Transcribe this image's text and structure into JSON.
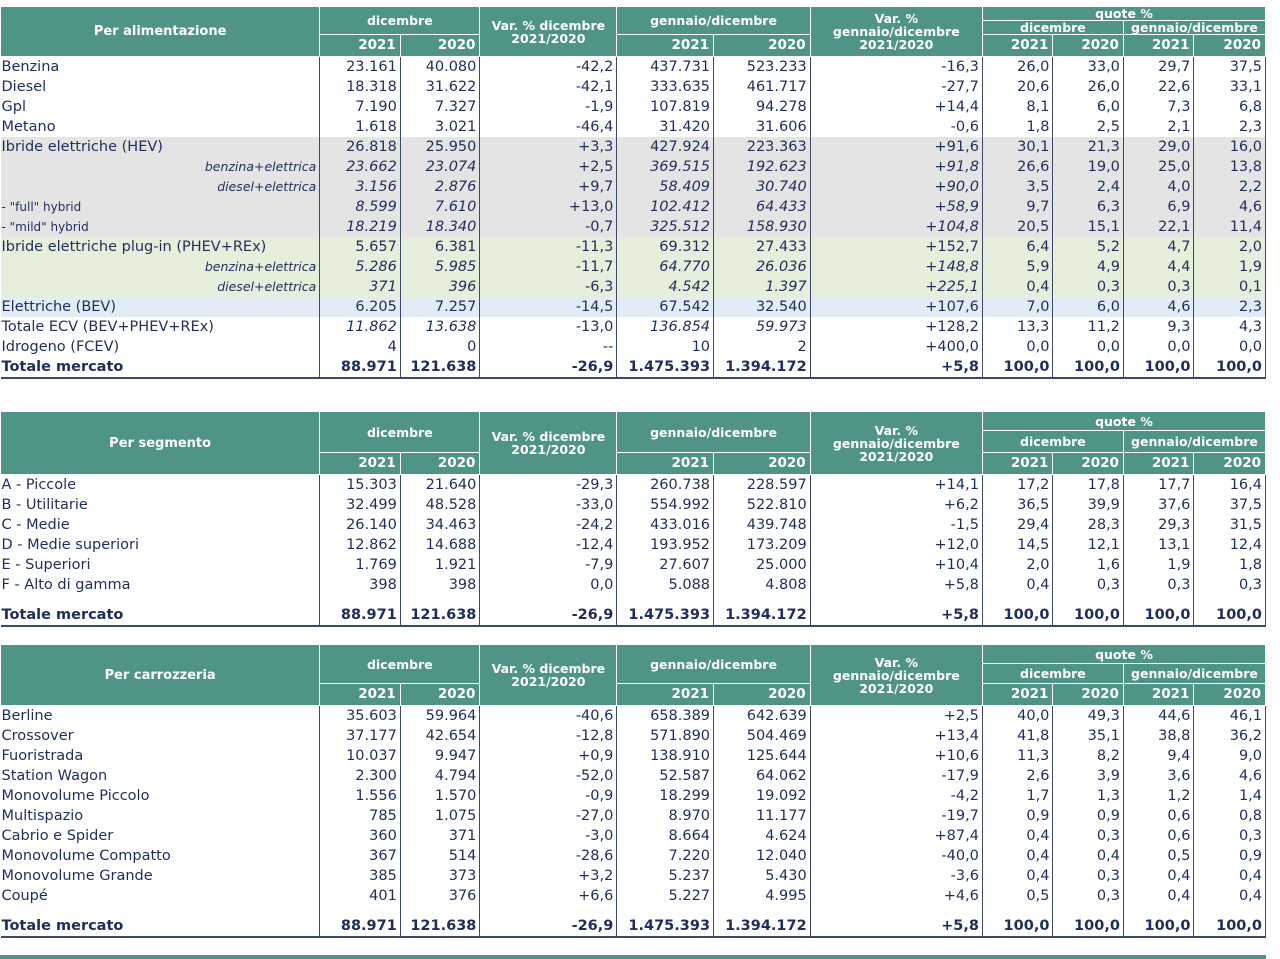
{
  "labels": {
    "dicembre": "dicembre",
    "gennaio_dicembre": "gennaio/dicembre",
    "var_dic": "Var. % dicembre 2021/2020",
    "var_gen": "Var. % gennaio/dicembre 2021/2020",
    "quote": "quote %",
    "y2021": "2021",
    "y2020": "2020"
  },
  "alimentazione": {
    "title": "Per alimentazione",
    "rows": [
      [
        "Benzina",
        "23.161",
        "40.080",
        "-42,2",
        "437.731",
        "523.233",
        "-16,3",
        "26,0",
        "33,0",
        "29,7",
        "37,5"
      ],
      [
        "Diesel",
        "18.318",
        "31.622",
        "-42,1",
        "333.635",
        "461.717",
        "-27,7",
        "20,6",
        "26,0",
        "22,6",
        "33,1"
      ],
      [
        "Gpl",
        "7.190",
        "7.327",
        "-1,9",
        "107.819",
        "94.278",
        "+14,4",
        "8,1",
        "6,0",
        "7,3",
        "6,8"
      ],
      [
        "Metano",
        "1.618",
        "3.021",
        "-46,4",
        "31.420",
        "31.606",
        "-0,6",
        "1,8",
        "2,5",
        "2,1",
        "2,3"
      ],
      [
        "Ibride elettriche (HEV)",
        "26.818",
        "25.950",
        "+3,3",
        "427.924",
        "223.363",
        "+91,6",
        "30,1",
        "21,3",
        "29,0",
        "16,0"
      ],
      [
        "benzina+elettrica",
        "23.662",
        "23.074",
        "+2,5",
        "369.515",
        "192.623",
        "+91,8",
        "26,6",
        "19,0",
        "25,0",
        "13,8"
      ],
      [
        "diesel+elettrica",
        "3.156",
        "2.876",
        "+9,7",
        "58.409",
        "30.740",
        "+90,0",
        "3,5",
        "2,4",
        "4,0",
        "2,2"
      ],
      [
        "- \"full\" hybrid",
        "8.599",
        "7.610",
        "+13,0",
        "102.412",
        "64.433",
        "+58,9",
        "9,7",
        "6,3",
        "6,9",
        "4,6"
      ],
      [
        "- \"mild\" hybrid",
        "18.219",
        "18.340",
        "-0,7",
        "325.512",
        "158.930",
        "+104,8",
        "20,5",
        "15,1",
        "22,1",
        "11,4"
      ],
      [
        "Ibride elettriche plug-in (PHEV+REx)",
        "5.657",
        "6.381",
        "-11,3",
        "69.312",
        "27.433",
        "+152,7",
        "6,4",
        "5,2",
        "4,7",
        "2,0"
      ],
      [
        "benzina+elettrica",
        "5.286",
        "5.985",
        "-11,7",
        "64.770",
        "26.036",
        "+148,8",
        "5,9",
        "4,9",
        "4,4",
        "1,9"
      ],
      [
        "diesel+elettrica",
        "371",
        "396",
        "-6,3",
        "4.542",
        "1.397",
        "+225,1",
        "0,4",
        "0,3",
        "0,3",
        "0,1"
      ],
      [
        "Elettriche (BEV)",
        "6.205",
        "7.257",
        "-14,5",
        "67.542",
        "32.540",
        "+107,6",
        "7,0",
        "6,0",
        "4,6",
        "2,3"
      ],
      [
        "Totale ECV (BEV+PHEV+REx)",
        "11.862",
        "13.638",
        "-13,0",
        "136.854",
        "59.973",
        "+128,2",
        "13,3",
        "11,2",
        "9,3",
        "4,3"
      ],
      [
        "Idrogeno (FCEV)",
        "4",
        "0",
        "--",
        "10",
        "2",
        "+400,0",
        "0,0",
        "0,0",
        "0,0",
        "0,0"
      ]
    ],
    "total": [
      "Totale mercato",
      "88.971",
      "121.638",
      "-26,9",
      "1.475.393",
      "1.394.172",
      "+5,8",
      "100,0",
      "100,0",
      "100,0",
      "100,0"
    ]
  },
  "segmento": {
    "title": "Per segmento",
    "rows": [
      [
        "A - Piccole",
        "15.303",
        "21.640",
        "-29,3",
        "260.738",
        "228.597",
        "+14,1",
        "17,2",
        "17,8",
        "17,7",
        "16,4"
      ],
      [
        "B - Utilitarie",
        "32.499",
        "48.528",
        "-33,0",
        "554.992",
        "522.810",
        "+6,2",
        "36,5",
        "39,9",
        "37,6",
        "37,5"
      ],
      [
        "C - Medie",
        "26.140",
        "34.463",
        "-24,2",
        "433.016",
        "439.748",
        "-1,5",
        "29,4",
        "28,3",
        "29,3",
        "31,5"
      ],
      [
        "D - Medie superiori",
        "12.862",
        "14.688",
        "-12,4",
        "193.952",
        "173.209",
        "+12,0",
        "14,5",
        "12,1",
        "13,1",
        "12,4"
      ],
      [
        "E - Superiori",
        "1.769",
        "1.921",
        "-7,9",
        "27.607",
        "25.000",
        "+10,4",
        "2,0",
        "1,6",
        "1,9",
        "1,8"
      ],
      [
        "F - Alto di gamma",
        "398",
        "398",
        "0,0",
        "5.088",
        "4.808",
        "+5,8",
        "0,4",
        "0,3",
        "0,3",
        "0,3"
      ]
    ],
    "total": [
      "Totale mercato",
      "88.971",
      "121.638",
      "-26,9",
      "1.475.393",
      "1.394.172",
      "+5,8",
      "100,0",
      "100,0",
      "100,0",
      "100,0"
    ]
  },
  "carrozzeria": {
    "title": "Per carrozzeria",
    "rows": [
      [
        "Berline",
        "35.603",
        "59.964",
        "-40,6",
        "658.389",
        "642.639",
        "+2,5",
        "40,0",
        "49,3",
        "44,6",
        "46,1"
      ],
      [
        "Crossover",
        "37.177",
        "42.654",
        "-12,8",
        "571.890",
        "504.469",
        "+13,4",
        "41,8",
        "35,1",
        "38,8",
        "36,2"
      ],
      [
        "Fuoristrada",
        "10.037",
        "9.947",
        "+0,9",
        "138.910",
        "125.644",
        "+10,6",
        "11,3",
        "8,2",
        "9,4",
        "9,0"
      ],
      [
        "Station Wagon",
        "2.300",
        "4.794",
        "-52,0",
        "52.587",
        "64.062",
        "-17,9",
        "2,6",
        "3,9",
        "3,6",
        "4,6"
      ],
      [
        "Monovolume Piccolo",
        "1.556",
        "1.570",
        "-0,9",
        "18.299",
        "19.092",
        "-4,2",
        "1,7",
        "1,3",
        "1,2",
        "1,4"
      ],
      [
        "Multispazio",
        "785",
        "1.075",
        "-27,0",
        "8.970",
        "11.177",
        "-19,7",
        "0,9",
        "0,9",
        "0,6",
        "0,8"
      ],
      [
        "Cabrio e Spider",
        "360",
        "371",
        "-3,0",
        "8.664",
        "4.624",
        "+87,4",
        "0,4",
        "0,3",
        "0,6",
        "0,3"
      ],
      [
        "Monovolume Compatto",
        "367",
        "514",
        "-28,6",
        "7.220",
        "12.040",
        "-40,0",
        "0,4",
        "0,4",
        "0,5",
        "0,9"
      ],
      [
        "Monovolume Grande",
        "385",
        "373",
        "+3,2",
        "5.237",
        "5.430",
        "-3,6",
        "0,4",
        "0,3",
        "0,4",
        "0,4"
      ],
      [
        "Coupé",
        "401",
        "376",
        "+6,6",
        "5.227",
        "4.995",
        "+4,6",
        "0,5",
        "0,3",
        "0,4",
        "0,4"
      ]
    ],
    "total": [
      "Totale mercato",
      "88.971",
      "121.638",
      "-26,9",
      "1.475.393",
      "1.394.172",
      "+5,8",
      "100,0",
      "100,0",
      "100,0",
      "100,0"
    ]
  }
}
